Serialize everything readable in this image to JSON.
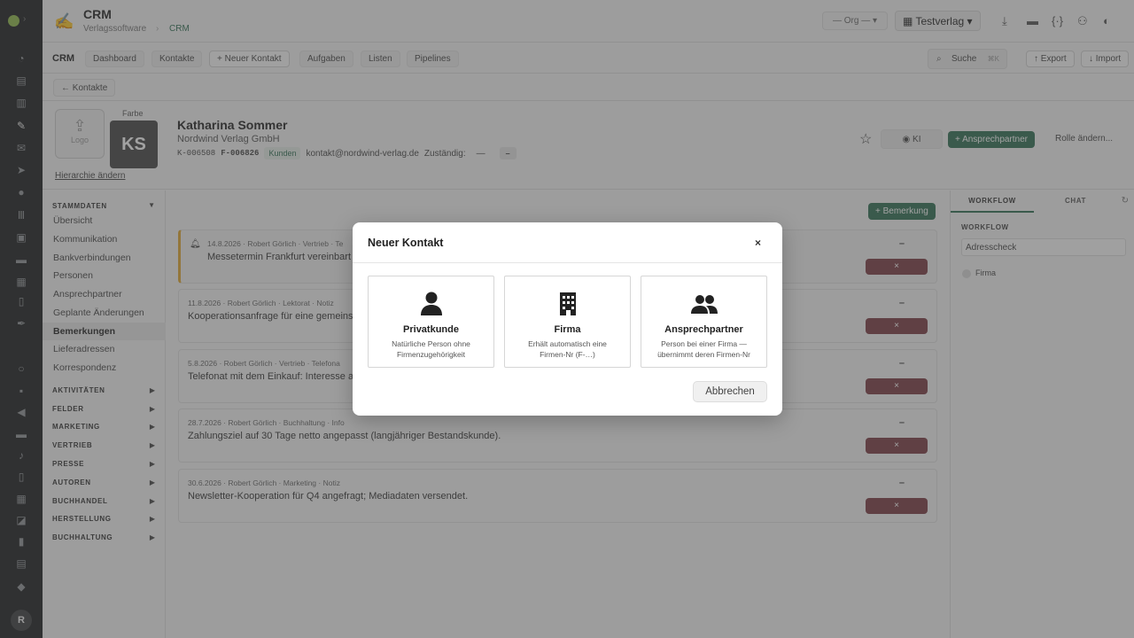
{
  "app": {
    "title": "CRM",
    "breadcrumb": [
      "Verlagssoftware",
      "CRM"
    ]
  },
  "topbar": {
    "org_selector": "— Org —",
    "verlag_selector": "Testverlag"
  },
  "nav": {
    "section": "CRM",
    "items": [
      "Dashboard",
      "Kontakte",
      "+ Neuer Kontakt",
      "Aufgaben",
      "Listen",
      "Pipelines"
    ],
    "search_label": "Suche",
    "search_shortcut": "⌘K",
    "export_label": "↑ Export",
    "import_label": "↓ Import"
  },
  "back_button": "← Kontakte",
  "contact": {
    "logo_label": "Logo",
    "farbe_label": "Farbe",
    "initials": "KS",
    "hierarchy_link": "Hierarchie ändern",
    "name": "Katharina Sommer",
    "company": "Nordwind Verlag GmbH",
    "contact_no": "K-006508",
    "company_no": "F-006826",
    "tag": "Kunden",
    "email": "kontakt@nordwind-verlag.de",
    "zustaendig_label": "Zuständig:",
    "zustaendig_value": "—",
    "zustaendig_badge": "–",
    "ki_label": "KI",
    "add_contact_person": "+ Ansprechpartner",
    "change_role": "Rolle ändern..."
  },
  "sidebar": {
    "stammdaten_label": "STAMMDATEN",
    "stammdaten_items": [
      "Übersicht",
      "Kommunikation",
      "Bankverbindungen",
      "Personen",
      "Ansprechpartner",
      "Geplante Änderungen",
      "Bemerkungen",
      "Lieferadressen",
      "Korrespondenz"
    ],
    "active_item": "Bemerkungen",
    "sections": [
      "AKTIVITÄTEN",
      "FELDER",
      "MARKETING",
      "VERTRIEB",
      "PRESSE",
      "AUTOREN",
      "BUCHHANDEL",
      "HERSTELLUNG",
      "BUCHHALTUNG"
    ]
  },
  "notes": {
    "add_button": "+ Bemerkung",
    "items": [
      {
        "meta": "14.8.2026 · Robert Görlich · Vertrieb · Te",
        "text": "Messetermin Frankfurt vereinbart",
        "pinned": true
      },
      {
        "meta": "11.8.2026 · Robert Görlich · Lektorat · Notiz",
        "text": "Kooperationsanfrage für eine gemeins",
        "pinned": false
      },
      {
        "meta": "5.8.2026 · Robert Görlich · Vertrieb · Telefona",
        "text": "Telefonat mit dem Einkauf: Interesse a",
        "pinned": false
      },
      {
        "meta": "28.7.2026 · Robert Görlich · Buchhaltung · Info",
        "text": "Zahlungsziel auf 30 Tage netto angepasst (langjähriger Bestandskunde).",
        "pinned": false
      },
      {
        "meta": "30.6.2026 · Robert Görlich · Marketing · Notiz",
        "text": "Newsletter-Kooperation für Q4 angefragt; Mediadaten versendet.",
        "pinned": false
      }
    ],
    "dash": "–",
    "delete_icon": "×"
  },
  "right_panel": {
    "tabs": [
      "WORKFLOW",
      "CHAT"
    ],
    "heading": "WORKFLOW",
    "input_value": "Adresscheck",
    "option": "Firma"
  },
  "modal": {
    "title": "Neuer Kontakt",
    "close": "×",
    "options": [
      {
        "icon": "person-icon",
        "title": "Privatkunde",
        "desc1": "Natürliche Person ohne",
        "desc2": "Firmenzugehörigkeit"
      },
      {
        "icon": "building-icon",
        "title": "Firma",
        "desc1": "Erhält automatisch eine",
        "desc2": "Firmen-Nr (F-…)"
      },
      {
        "icon": "people-icon",
        "title": "Ansprechpartner",
        "desc1": "Person bei einer Firma —",
        "desc2": "übernimmt deren Firmen-Nr"
      }
    ],
    "cancel": "Abbrechen"
  },
  "user": {
    "initial": "R"
  },
  "colors": {
    "accent": "#2f6e52",
    "danger": "#7a3a42",
    "pinned": "#e0a72e"
  }
}
